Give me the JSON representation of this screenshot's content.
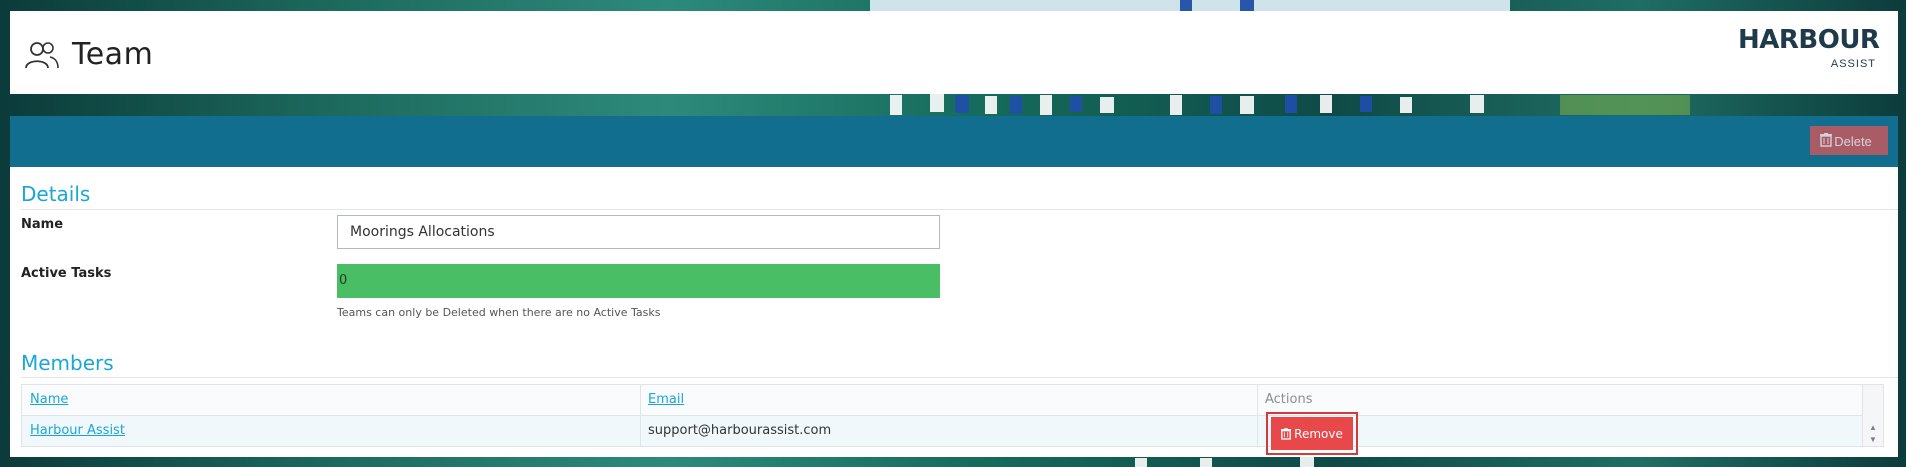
{
  "header": {
    "title": "Team",
    "logo_word": "HARBOUR",
    "logo_sub": "ASSIST"
  },
  "toolbar": {
    "delete_label": "Delete"
  },
  "details": {
    "section_title": "Details",
    "name_label": "Name",
    "name_value": "Moorings Allocations",
    "active_tasks_label": "Active Tasks",
    "active_tasks_value": "0",
    "help_text": "Teams can only be Deleted when there are no Active Tasks"
  },
  "members": {
    "section_title": "Members",
    "columns": [
      "Name",
      "Email",
      "Actions"
    ],
    "rows": [
      {
        "name": "Harbour Assist",
        "email": "support@harbourassist.com",
        "action": "Remove"
      }
    ]
  },
  "colors": {
    "accent": "#19a7d8",
    "bar": "#116e8f",
    "success": "#49be65",
    "danger": "#e8484a"
  },
  "icons": [
    "team-icon",
    "trash-icon",
    "scroll-up-icon",
    "scroll-down-icon"
  ]
}
